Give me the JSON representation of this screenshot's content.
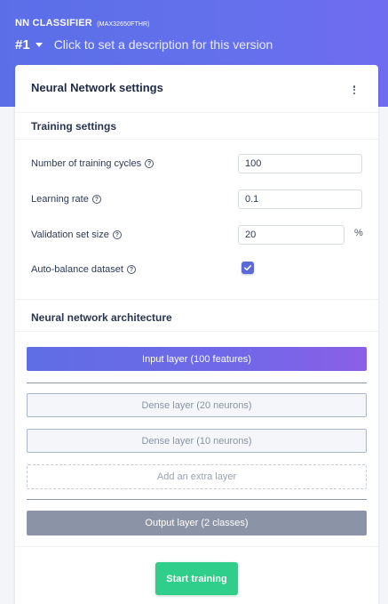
{
  "header": {
    "title": "NN CLASSIFIER",
    "model_id": "(MAX32650FTHR)",
    "version": "#1",
    "version_description": "Click to set a description for this version"
  },
  "card": {
    "title": "Neural Network settings",
    "menu_icon": "kebab-menu-icon"
  },
  "training_settings": {
    "section_title": "Training settings",
    "training_cycles": {
      "label": "Number of training cycles",
      "value": "100"
    },
    "learning_rate": {
      "label": "Learning rate",
      "value": "0.1"
    },
    "validation_size": {
      "label": "Validation set size",
      "value": "20",
      "unit": "%"
    },
    "auto_balance": {
      "label": "Auto-balance dataset",
      "checked": true
    },
    "help_icon": "question-circle-icon"
  },
  "architecture": {
    "section_title": "Neural network architecture",
    "input_layer": "Input layer (100 features)",
    "dense_layers": [
      "Dense layer (20 neurons)",
      "Dense layer (10 neurons)"
    ],
    "add_layer": "Add an extra layer",
    "output_layer": "Output layer (2 classes)"
  },
  "actions": {
    "start_training": "Start training"
  },
  "colors": {
    "header_bg": "#5b6ee8",
    "checkbox": "#5a6ad6",
    "start_button": "#2fce8a",
    "output_layer": "#8b93a6"
  }
}
